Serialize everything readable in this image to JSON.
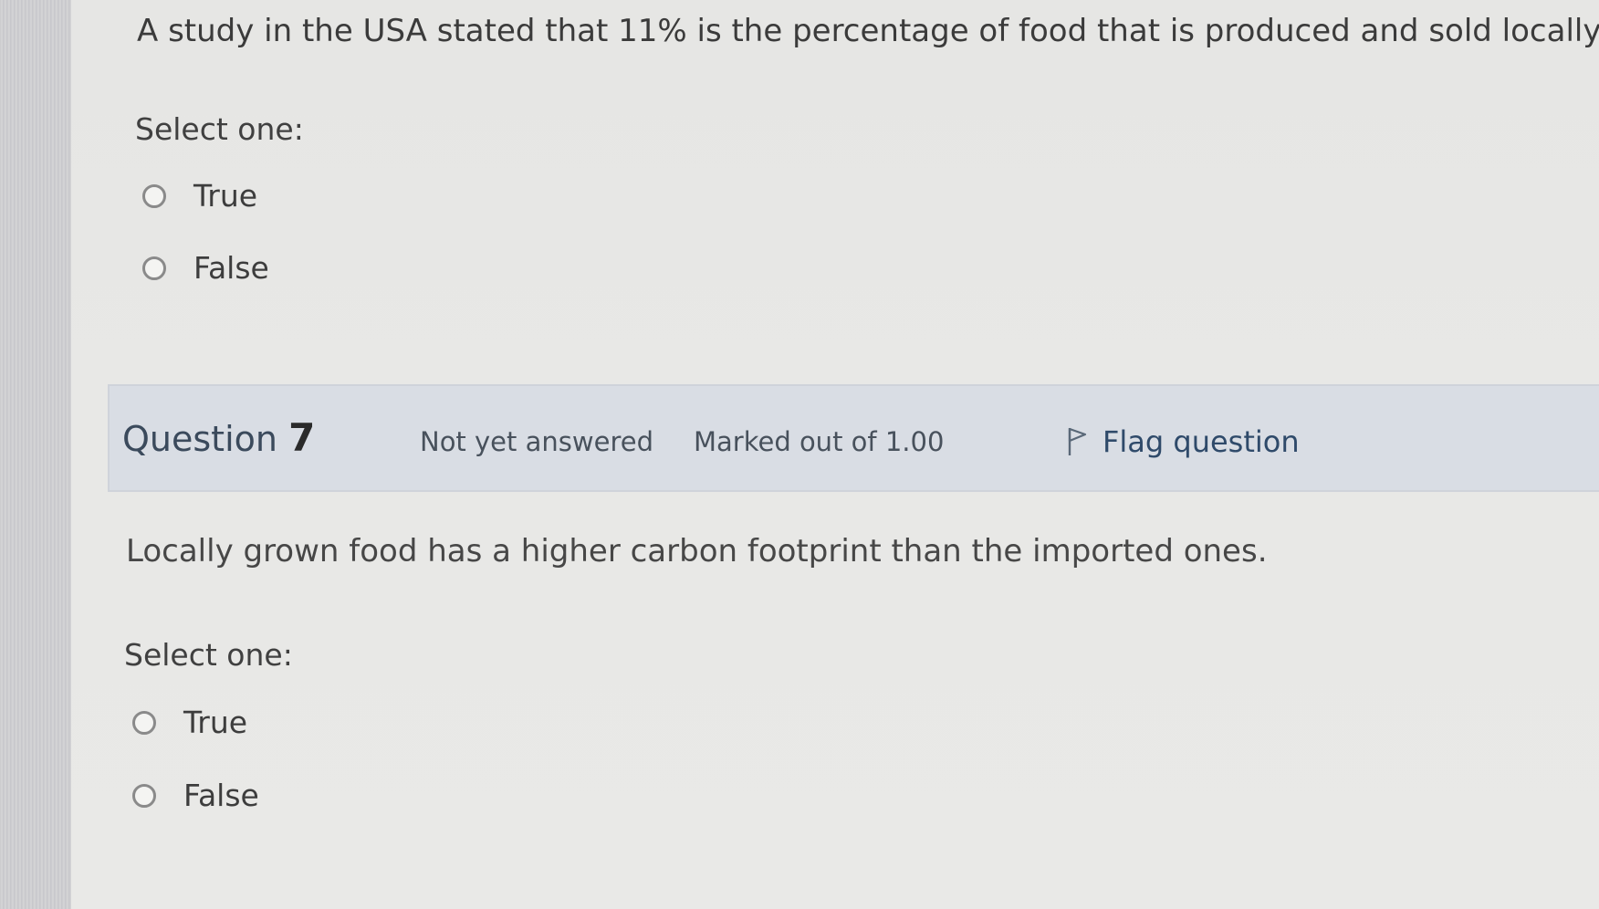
{
  "question6": {
    "text": "A study in the USA stated that 11% is the percentage of food that is produced and sold locally",
    "select_label": "Select one:",
    "options": [
      {
        "label": "True"
      },
      {
        "label": "False"
      }
    ]
  },
  "question7": {
    "header": {
      "prefix": "Question",
      "number": "7",
      "state": "Not yet answered",
      "grade": "Marked out of 1.00",
      "flag_label": "Flag question",
      "flag_icon": "flag-icon"
    },
    "text": "Locally grown food has a higher carbon footprint than the imported ones.",
    "select_label": "Select one:",
    "options": [
      {
        "label": "True"
      },
      {
        "label": "False"
      }
    ]
  },
  "colors": {
    "background": "#e6e6e4",
    "header_bg": "#d9dde4",
    "flag_text": "#2f4a6a"
  }
}
